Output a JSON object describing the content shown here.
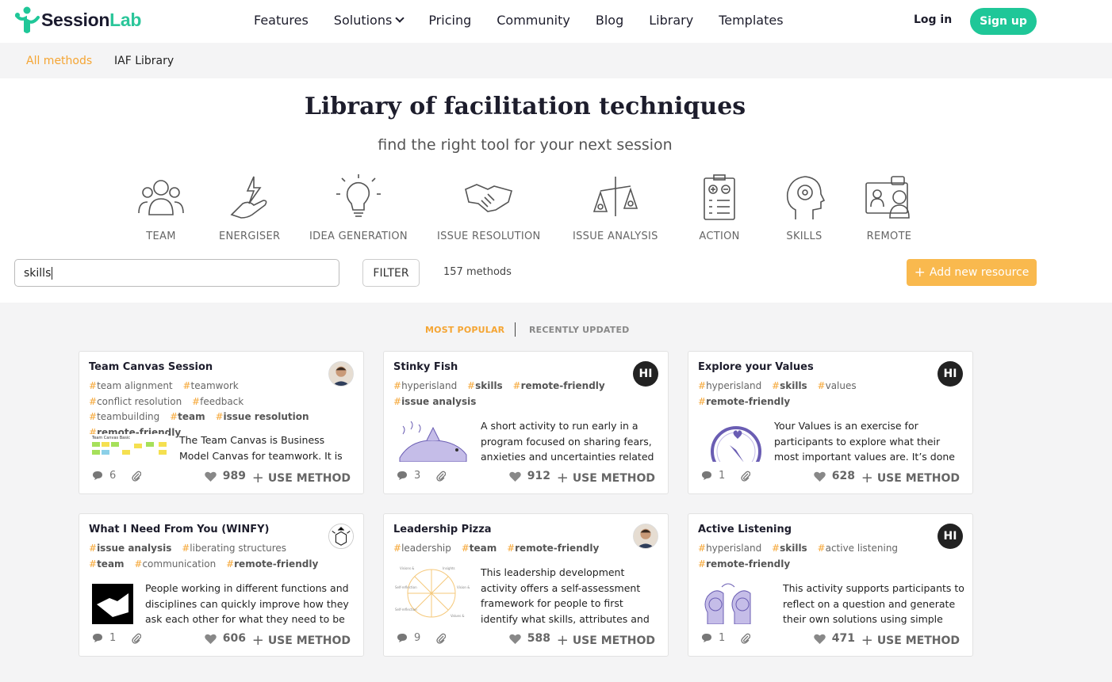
{
  "brand": {
    "name_part1": "Session",
    "name_part2": "Lab",
    "color": "#1fc798"
  },
  "nav": {
    "items": [
      "Features",
      "Solutions",
      "Pricing",
      "Community",
      "Blog",
      "Library",
      "Templates"
    ],
    "login": "Log in",
    "signup": "Sign up"
  },
  "subnav": {
    "all_methods": "All methods",
    "iaf": "IAF Library"
  },
  "hero": {
    "title": "Library of facilitation techniques",
    "subtitle": "find the right tool for your next session",
    "categories": [
      {
        "label": "TEAM",
        "icon": "team-icon"
      },
      {
        "label": "ENERGISER",
        "icon": "energiser-icon"
      },
      {
        "label": "IDEA GENERATION",
        "icon": "lightbulb-icon"
      },
      {
        "label": "ISSUE RESOLUTION",
        "icon": "handshake-icon"
      },
      {
        "label": "ISSUE ANALYSIS",
        "icon": "scales-icon"
      },
      {
        "label": "ACTION",
        "icon": "clipboard-icon"
      },
      {
        "label": "SKILLS",
        "icon": "head-gear-icon"
      },
      {
        "label": "REMOTE",
        "icon": "remote-icon"
      }
    ]
  },
  "toolbar": {
    "search_value": "skills",
    "filter_label": "FILTER",
    "count": "157 methods",
    "add_label": "Add new resource"
  },
  "sort": {
    "popular": "MOST POPULAR",
    "recent": "RECENTLY UPDATED"
  },
  "cards": [
    {
      "title": "Team Canvas Session",
      "avatar": "photo",
      "tags": [
        [
          "team alignment",
          false
        ],
        [
          "teamwork",
          false
        ],
        [
          "conflict resolution",
          false
        ],
        [
          "feedback",
          false
        ],
        [
          "teambuilding",
          false
        ],
        [
          "team",
          true
        ],
        [
          "issue resolution",
          true
        ],
        [
          "remote-friendly",
          true
        ]
      ],
      "desc": "The Team Canvas is Business Model Canvas for teamwork. It is an",
      "comments": "6",
      "likes": "989",
      "use": "USE METHOD"
    },
    {
      "title": "Stinky Fish",
      "avatar": "HI",
      "tags": [
        [
          "hyperisland",
          false
        ],
        [
          "skills",
          true
        ],
        [
          "remote-friendly",
          true
        ],
        [
          "issue analysis",
          true
        ]
      ],
      "desc": "A short activity to run early in a program focused on sharing fears, anxieties and uncertainties related",
      "comments": "3",
      "likes": "912",
      "use": "USE METHOD"
    },
    {
      "title": "Explore your Values",
      "avatar": "HI",
      "tags": [
        [
          "hyperisland",
          false
        ],
        [
          "skills",
          true
        ],
        [
          "values",
          false
        ],
        [
          "remote-friendly",
          true
        ]
      ],
      "desc": "Your Values is an exercise for participants to explore what their most important values are. It’s done in an",
      "comments": "1",
      "likes": "628",
      "use": "USE METHOD"
    },
    {
      "title": "What I Need From You (WINFY)",
      "avatar": "lib",
      "tags": [
        [
          "issue analysis",
          true
        ],
        [
          "liberating structures",
          false
        ],
        [
          "team",
          true
        ],
        [
          "communication",
          false
        ],
        [
          "remote-friendly",
          true
        ]
      ],
      "desc": "People working in different functions and disciplines can quickly improve how they ask each other for what they need to be",
      "comments": "1",
      "likes": "606",
      "use": "USE METHOD"
    },
    {
      "title": "Leadership Pizza",
      "avatar": "photo",
      "tags": [
        [
          "leadership",
          false
        ],
        [
          "team",
          true
        ],
        [
          "remote-friendly",
          true
        ]
      ],
      "desc": "This leadership development activity offers a self-assessment framework for people to first identify what skills, attributes and",
      "comments": "9",
      "likes": "588",
      "use": "USE METHOD"
    },
    {
      "title": "Active Listening",
      "avatar": "HI",
      "tags": [
        [
          "hyperisland",
          false
        ],
        [
          "skills",
          true
        ],
        [
          "active listening",
          false
        ],
        [
          "remote-friendly",
          true
        ]
      ],
      "desc": "This activity supports participants to reflect on a question and generate their own solutions using simple",
      "comments": "1",
      "likes": "471",
      "use": "USE METHOD"
    }
  ]
}
